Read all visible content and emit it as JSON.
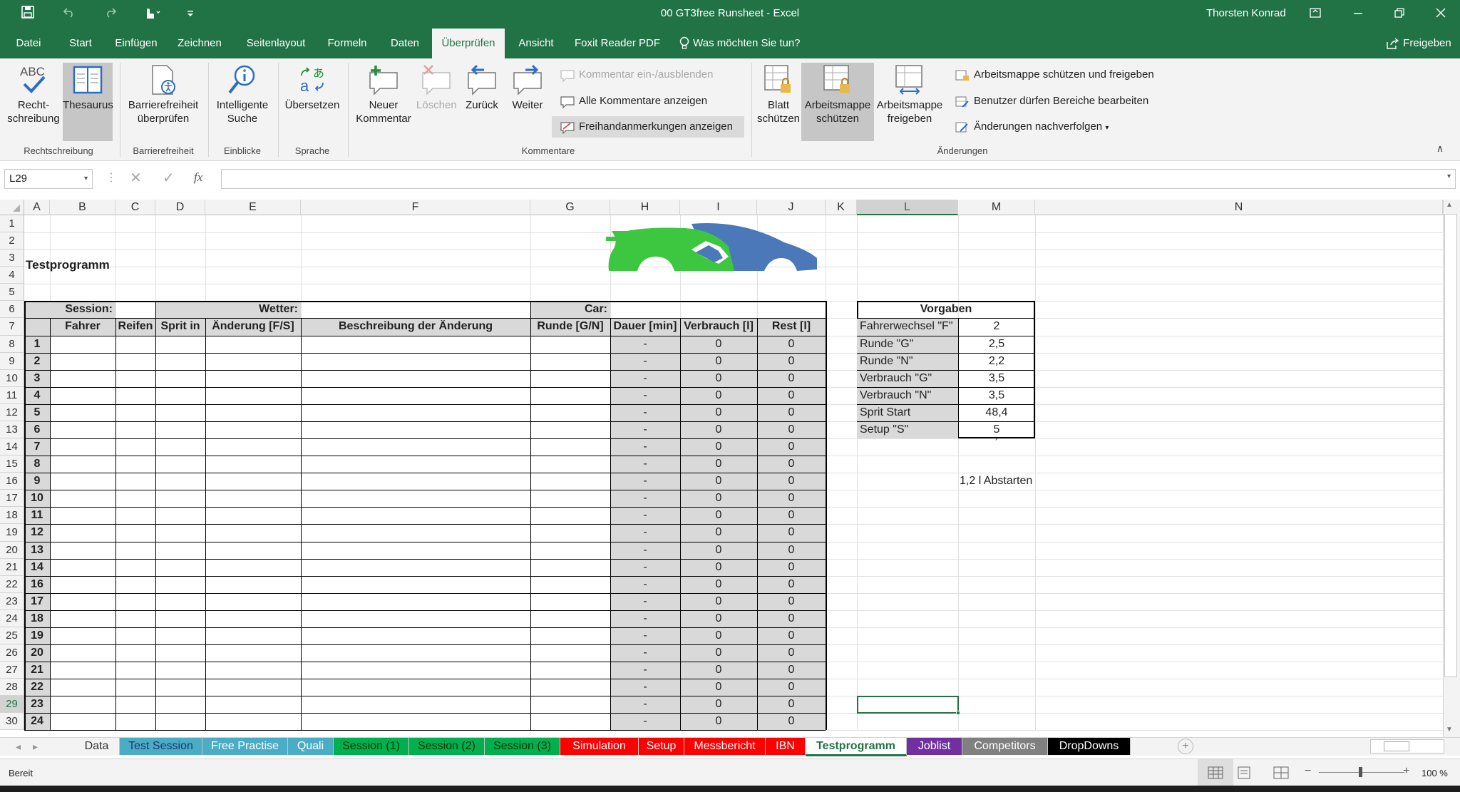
{
  "colors": {
    "excel_green": "#217346",
    "ribbon_bg": "#f3f3f3",
    "header_gray": "#d9d9d9",
    "dash_gray": "#d9d9d9",
    "logo_green": "#3dc740",
    "logo_blue": "#4a78b8"
  },
  "titlebar": {
    "title": "00 GT3free Runsheet  -  Excel",
    "user": "Thorsten Konrad",
    "icons": [
      "save-icon",
      "undo-icon",
      "redo-icon",
      "touch-mode-icon",
      "customize-icon"
    ]
  },
  "tabs": [
    "Datei",
    "Start",
    "Einfügen",
    "Zeichnen",
    "Seitenlayout",
    "Formeln",
    "Daten",
    "Überprüfen",
    "Ansicht",
    "Foxit Reader PDF"
  ],
  "active_tab": "Überprüfen",
  "tell_me": "Was möchten Sie tun?",
  "share": "Freigeben",
  "ribbon": {
    "spelling": "Recht-\nschreibung",
    "thesaurus": "Thesaurus",
    "accessibility": "Barrierefreiheit\nüberprüfen",
    "smart_lookup": "Intelligente\nSuche",
    "translate": "Übersetzen",
    "new_comment": "Neuer\nKommentar",
    "delete": "Löschen",
    "previous": "Zurück",
    "next": "Weiter",
    "show_hide_comment": "Kommentar ein-/ausblenden",
    "show_all_comments": "Alle Kommentare anzeigen",
    "show_ink": "Freihandanmerkungen anzeigen",
    "protect_sheet": "Blatt\nschützen",
    "protect_workbook": "Arbeitsmappe\nschützen",
    "share_workbook": "Arbeitsmappe\nfreigeben",
    "protect_share": "Arbeitsmappe schützen und freigeben",
    "allow_edit_ranges": "Benutzer dürfen Bereiche bearbeiten",
    "track_changes": "Änderungen nachverfolgen",
    "groups": [
      "Rechtschreibung",
      "Barrierefreiheit",
      "Einblicke",
      "Sprache",
      "Kommentare",
      "Änderungen"
    ]
  },
  "namebox": "L29",
  "fx_label": "fx",
  "columns": [
    "A",
    "B",
    "C",
    "D",
    "E",
    "F",
    "G",
    "H",
    "I",
    "J",
    "K",
    "L",
    "M",
    "N"
  ],
  "selected_column": "L",
  "selected_row": "29",
  "rows": [
    "1",
    "2",
    "3",
    "4",
    "5",
    "6",
    "7",
    "8",
    "9",
    "10",
    "11",
    "12",
    "13",
    "14",
    "15",
    "16",
    "17",
    "18",
    "19",
    "20",
    "21",
    "22",
    "23",
    "24",
    "25",
    "26",
    "27",
    "28",
    "29",
    "30"
  ],
  "sheet": {
    "title": "Testprogramm",
    "session_label": "Session:",
    "weather_label": "Wetter:",
    "car_label": "Car:",
    "headers": [
      "Fahrer",
      "Reifen",
      "Sprit in",
      "Änderung [F/S]",
      "Beschreibung der Änderung",
      "Runde [G/N]",
      "Dauer [min]",
      "Verbrauch [l]",
      "Rest [l]"
    ],
    "run_numbers": [
      "1",
      "2",
      "3",
      "4",
      "5",
      "6",
      "7",
      "8",
      "9",
      "10",
      "11",
      "12",
      "13",
      "14",
      "16",
      "17",
      "18",
      "19",
      "20",
      "21",
      "22",
      "23",
      "24"
    ],
    "dauer": "-",
    "verbrauch": "0",
    "rest": "0",
    "vorgaben_title": "Vorgaben",
    "vorgaben": [
      {
        "label": "Fahrerwechsel \"F\"",
        "value": "2"
      },
      {
        "label": "Runde \"G\"",
        "value": "2,5"
      },
      {
        "label": "Runde \"N\"",
        "value": "2,2"
      },
      {
        "label": "Verbrauch \"G\"",
        "value": "3,5"
      },
      {
        "label": "Verbrauch \"N\"",
        "value": "3,5"
      },
      {
        "label": "Sprit Start",
        "value": "48,4"
      },
      {
        "label": "Setup \"S\"",
        "value": "5"
      }
    ],
    "tick_mark": "´",
    "note": "1,2 l Abstarten"
  },
  "sheet_tabs": [
    {
      "name": "Data",
      "bg": "#f3f3f3",
      "fg": "#333333"
    },
    {
      "name": "Test Session",
      "bg": "#4bacc6",
      "fg": "#1f3864"
    },
    {
      "name": "Free Practise",
      "bg": "#4bacc6",
      "fg": "#ffffff"
    },
    {
      "name": "Quali",
      "bg": "#4bacc6",
      "fg": "#ffffff"
    },
    {
      "name": "Session (1)",
      "bg": "#00b050",
      "fg": "#003300"
    },
    {
      "name": "Session (2)",
      "bg": "#00b050",
      "fg": "#003300"
    },
    {
      "name": "Session (3)",
      "bg": "#00b050",
      "fg": "#003300"
    },
    {
      "name": "Simulation",
      "bg": "#ff0000",
      "fg": "#ffffff"
    },
    {
      "name": "Setup",
      "bg": "#ff0000",
      "fg": "#ffffff"
    },
    {
      "name": "Messbericht",
      "bg": "#ff0000",
      "fg": "#ffffff"
    },
    {
      "name": "IBN",
      "bg": "#ff0000",
      "fg": "#ffffff"
    },
    {
      "name": "Testprogramm",
      "bg": "#ffffff",
      "fg": "#217346"
    },
    {
      "name": "Joblist",
      "bg": "#7030a0",
      "fg": "#ffffff"
    },
    {
      "name": "Competitors",
      "bg": "#808080",
      "fg": "#ffffff"
    },
    {
      "name": "DropDowns",
      "bg": "#000000",
      "fg": "#ffffff"
    }
  ],
  "active_sheet": "Testprogramm",
  "status": {
    "ready": "Bereit",
    "zoom": "100 %",
    "zoom_minus": "−",
    "zoom_plus": "+"
  }
}
